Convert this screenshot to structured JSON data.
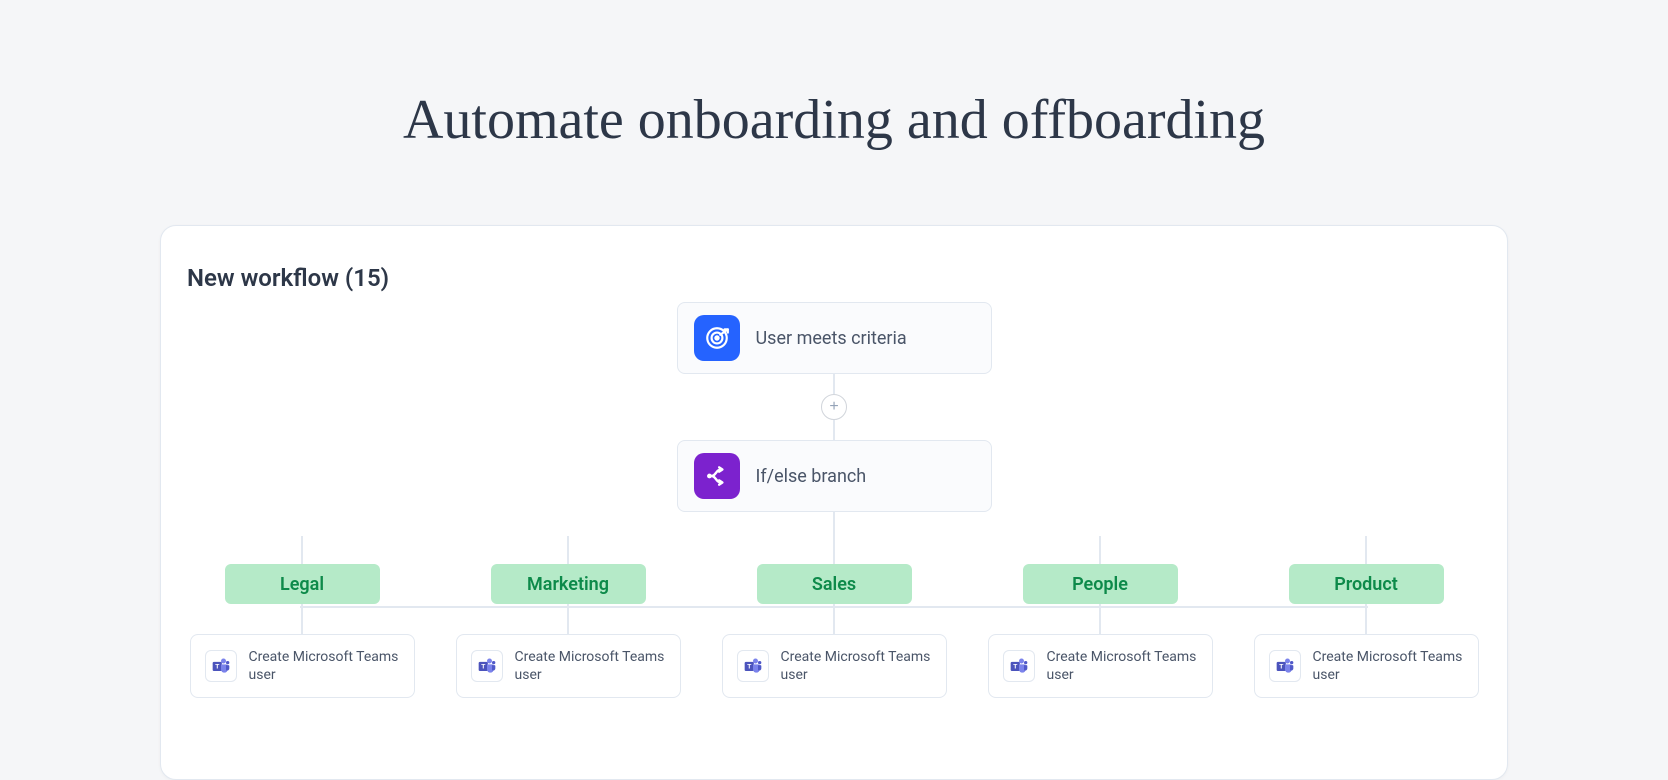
{
  "page": {
    "title": "Automate onboarding and offboarding"
  },
  "workflow": {
    "title": "New workflow (15)",
    "trigger_node": {
      "label": "User meets criteria"
    },
    "branch_node": {
      "label": "If/else branch"
    },
    "add_button": "+",
    "branches": [
      {
        "name": "Legal",
        "action": "Create Microsoft Teams user"
      },
      {
        "name": "Marketing",
        "action": "Create Microsoft Teams user"
      },
      {
        "name": "Sales",
        "action": "Create Microsoft Teams user"
      },
      {
        "name": "People",
        "action": "Create Microsoft Teams user"
      },
      {
        "name": "Product",
        "action": "Create Microsoft Teams user"
      }
    ]
  },
  "colors": {
    "trigger_icon_bg": "#2563ff",
    "branch_icon_bg": "#7c22ce",
    "branch_label_bg": "#b5eac8",
    "branch_label_text": "#0d8a4a"
  }
}
